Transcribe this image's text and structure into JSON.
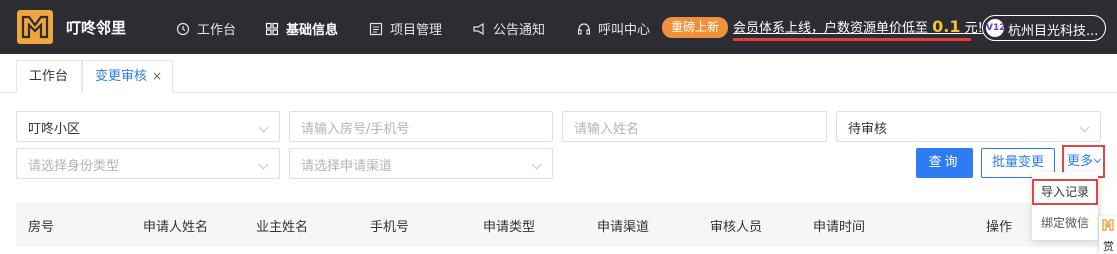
{
  "app": {
    "title": "叮咚邻里"
  },
  "nav": {
    "items": [
      {
        "label": "工作台",
        "icon": "clock-icon"
      },
      {
        "label": "基础信息",
        "icon": "grid-icon",
        "active": true
      },
      {
        "label": "项目管理",
        "icon": "list-icon"
      },
      {
        "label": "公告通知",
        "icon": "megaphone-icon"
      },
      {
        "label": "呼叫中心",
        "icon": "headset-icon"
      }
    ]
  },
  "promo": {
    "badge": "重磅上新",
    "text_before": "会员体系上线，户数资源单价低至 ",
    "number": "0.1",
    "text_after": " 元!"
  },
  "account": {
    "vip_level": "V12",
    "company": "杭州目光科技..."
  },
  "tabs": [
    {
      "label": "工作台"
    },
    {
      "label": "变更审核",
      "close": "×",
      "active": true
    }
  ],
  "filters": {
    "community": "叮咚小区",
    "room_phone_placeholder": "请输入房号/手机号",
    "name_placeholder": "请输入姓名",
    "status": "待审核",
    "identity_placeholder": "请选择身份类型",
    "channel_placeholder": "请选择申请渠道"
  },
  "buttons": {
    "query": "查询",
    "batch_change": "批量变更",
    "more": "更多"
  },
  "dropdown": {
    "import_records": "导入记录",
    "bind_wechat": "绑定微信"
  },
  "table": {
    "columns": [
      "房号",
      "申请人姓名",
      "业主姓名",
      "手机号",
      "申请类型",
      "申请渠道",
      "审核人员",
      "申请时间",
      "操作"
    ]
  },
  "side_widget": {
    "text": "赏"
  },
  "colors": {
    "header_bg": "#2b2d33",
    "brand": "#f0a53d",
    "primary": "#2d7cf1",
    "highlight": "#e64545"
  }
}
